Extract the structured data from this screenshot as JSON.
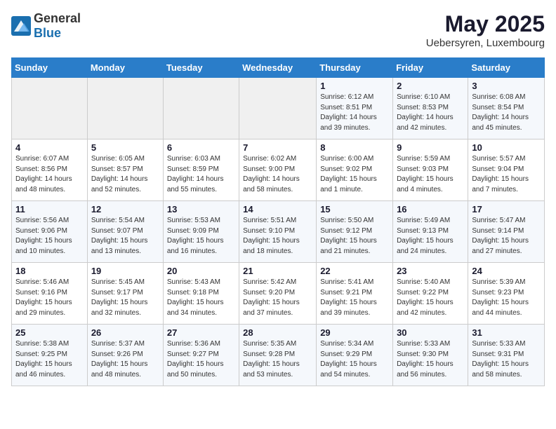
{
  "header": {
    "logo_general": "General",
    "logo_blue": "Blue",
    "month": "May 2025",
    "location": "Uebersyren, Luxembourg"
  },
  "days_of_week": [
    "Sunday",
    "Monday",
    "Tuesday",
    "Wednesday",
    "Thursday",
    "Friday",
    "Saturday"
  ],
  "weeks": [
    [
      {
        "day": "",
        "info": ""
      },
      {
        "day": "",
        "info": ""
      },
      {
        "day": "",
        "info": ""
      },
      {
        "day": "",
        "info": ""
      },
      {
        "day": "1",
        "info": "Sunrise: 6:12 AM\nSunset: 8:51 PM\nDaylight: 14 hours\nand 39 minutes."
      },
      {
        "day": "2",
        "info": "Sunrise: 6:10 AM\nSunset: 8:53 PM\nDaylight: 14 hours\nand 42 minutes."
      },
      {
        "day": "3",
        "info": "Sunrise: 6:08 AM\nSunset: 8:54 PM\nDaylight: 14 hours\nand 45 minutes."
      }
    ],
    [
      {
        "day": "4",
        "info": "Sunrise: 6:07 AM\nSunset: 8:56 PM\nDaylight: 14 hours\nand 48 minutes."
      },
      {
        "day": "5",
        "info": "Sunrise: 6:05 AM\nSunset: 8:57 PM\nDaylight: 14 hours\nand 52 minutes."
      },
      {
        "day": "6",
        "info": "Sunrise: 6:03 AM\nSunset: 8:59 PM\nDaylight: 14 hours\nand 55 minutes."
      },
      {
        "day": "7",
        "info": "Sunrise: 6:02 AM\nSunset: 9:00 PM\nDaylight: 14 hours\nand 58 minutes."
      },
      {
        "day": "8",
        "info": "Sunrise: 6:00 AM\nSunset: 9:02 PM\nDaylight: 15 hours\nand 1 minute."
      },
      {
        "day": "9",
        "info": "Sunrise: 5:59 AM\nSunset: 9:03 PM\nDaylight: 15 hours\nand 4 minutes."
      },
      {
        "day": "10",
        "info": "Sunrise: 5:57 AM\nSunset: 9:04 PM\nDaylight: 15 hours\nand 7 minutes."
      }
    ],
    [
      {
        "day": "11",
        "info": "Sunrise: 5:56 AM\nSunset: 9:06 PM\nDaylight: 15 hours\nand 10 minutes."
      },
      {
        "day": "12",
        "info": "Sunrise: 5:54 AM\nSunset: 9:07 PM\nDaylight: 15 hours\nand 13 minutes."
      },
      {
        "day": "13",
        "info": "Sunrise: 5:53 AM\nSunset: 9:09 PM\nDaylight: 15 hours\nand 16 minutes."
      },
      {
        "day": "14",
        "info": "Sunrise: 5:51 AM\nSunset: 9:10 PM\nDaylight: 15 hours\nand 18 minutes."
      },
      {
        "day": "15",
        "info": "Sunrise: 5:50 AM\nSunset: 9:12 PM\nDaylight: 15 hours\nand 21 minutes."
      },
      {
        "day": "16",
        "info": "Sunrise: 5:49 AM\nSunset: 9:13 PM\nDaylight: 15 hours\nand 24 minutes."
      },
      {
        "day": "17",
        "info": "Sunrise: 5:47 AM\nSunset: 9:14 PM\nDaylight: 15 hours\nand 27 minutes."
      }
    ],
    [
      {
        "day": "18",
        "info": "Sunrise: 5:46 AM\nSunset: 9:16 PM\nDaylight: 15 hours\nand 29 minutes."
      },
      {
        "day": "19",
        "info": "Sunrise: 5:45 AM\nSunset: 9:17 PM\nDaylight: 15 hours\nand 32 minutes."
      },
      {
        "day": "20",
        "info": "Sunrise: 5:43 AM\nSunset: 9:18 PM\nDaylight: 15 hours\nand 34 minutes."
      },
      {
        "day": "21",
        "info": "Sunrise: 5:42 AM\nSunset: 9:20 PM\nDaylight: 15 hours\nand 37 minutes."
      },
      {
        "day": "22",
        "info": "Sunrise: 5:41 AM\nSunset: 9:21 PM\nDaylight: 15 hours\nand 39 minutes."
      },
      {
        "day": "23",
        "info": "Sunrise: 5:40 AM\nSunset: 9:22 PM\nDaylight: 15 hours\nand 42 minutes."
      },
      {
        "day": "24",
        "info": "Sunrise: 5:39 AM\nSunset: 9:23 PM\nDaylight: 15 hours\nand 44 minutes."
      }
    ],
    [
      {
        "day": "25",
        "info": "Sunrise: 5:38 AM\nSunset: 9:25 PM\nDaylight: 15 hours\nand 46 minutes."
      },
      {
        "day": "26",
        "info": "Sunrise: 5:37 AM\nSunset: 9:26 PM\nDaylight: 15 hours\nand 48 minutes."
      },
      {
        "day": "27",
        "info": "Sunrise: 5:36 AM\nSunset: 9:27 PM\nDaylight: 15 hours\nand 50 minutes."
      },
      {
        "day": "28",
        "info": "Sunrise: 5:35 AM\nSunset: 9:28 PM\nDaylight: 15 hours\nand 53 minutes."
      },
      {
        "day": "29",
        "info": "Sunrise: 5:34 AM\nSunset: 9:29 PM\nDaylight: 15 hours\nand 54 minutes."
      },
      {
        "day": "30",
        "info": "Sunrise: 5:33 AM\nSunset: 9:30 PM\nDaylight: 15 hours\nand 56 minutes."
      },
      {
        "day": "31",
        "info": "Sunrise: 5:33 AM\nSunset: 9:31 PM\nDaylight: 15 hours\nand 58 minutes."
      }
    ]
  ]
}
